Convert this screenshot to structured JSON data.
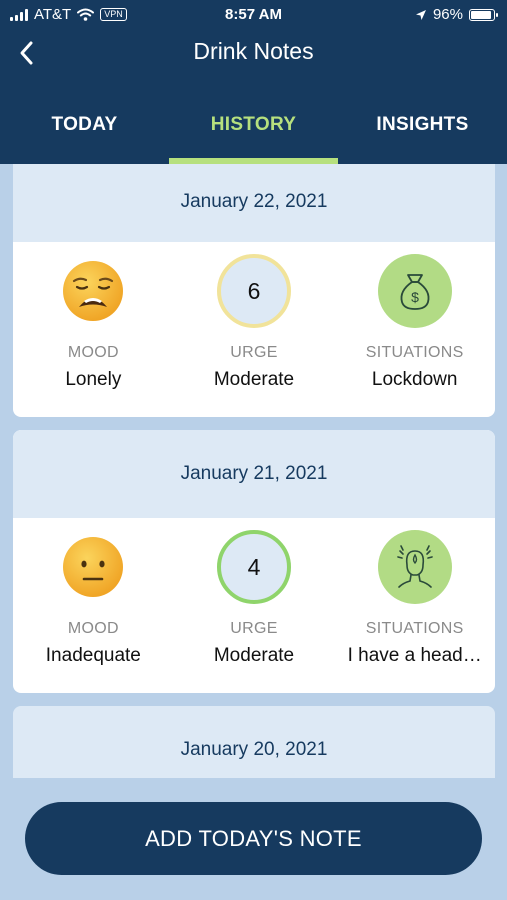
{
  "status_bar": {
    "carrier": "AT&T",
    "vpn": "VPN",
    "time": "8:57 AM",
    "battery": "96%"
  },
  "header": {
    "title": "Drink Notes"
  },
  "tabs": [
    {
      "label": "TODAY",
      "active": false
    },
    {
      "label": "HISTORY",
      "active": true
    },
    {
      "label": "INSIGHTS",
      "active": false
    }
  ],
  "entries": [
    {
      "date": "January 22, 2021",
      "mood": {
        "label": "MOOD",
        "value": "Lonely",
        "icon": "anguished-face-icon"
      },
      "urge": {
        "label": "URGE",
        "number": "6",
        "value": "Moderate",
        "ring_color": "#f1e39a"
      },
      "situations": {
        "label": "SITUATIONS",
        "value": "Lockdown",
        "icon": "money-bag-icon"
      }
    },
    {
      "date": "January 21, 2021",
      "mood": {
        "label": "MOOD",
        "value": "Inadequate",
        "icon": "neutral-face-icon"
      },
      "urge": {
        "label": "URGE",
        "number": "4",
        "value": "Moderate",
        "ring_color": "#8fd46b"
      },
      "situations": {
        "label": "SITUATIONS",
        "value": "I have a head…",
        "icon": "headache-icon"
      }
    },
    {
      "date": "January 20, 2021"
    }
  ],
  "add_button": {
    "label": "ADD TODAY'S NOTE"
  },
  "colors": {
    "navy": "#163a5f",
    "accent_green": "#b6e07e",
    "card_header": "#dde9f5",
    "background": "#b9d0e8"
  }
}
